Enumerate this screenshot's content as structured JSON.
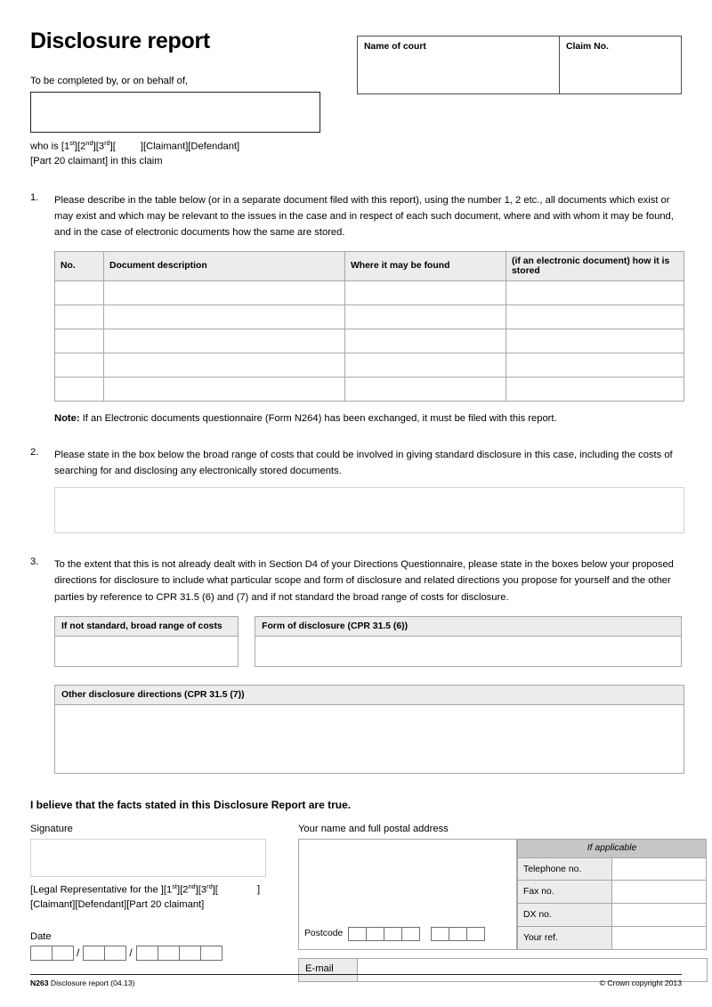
{
  "header": {
    "title": "Disclosure report",
    "lede": "To be completed by, or on behalf of,",
    "who_is_prefix": "who is [",
    "ord_1": "1",
    "ord_1_sup": "st",
    "ord_2": "2",
    "ord_2_sup": "nd",
    "ord_3": "3",
    "ord_3_sup": "rd",
    "who_is_suffix": "][Claimant][Defendant]",
    "who_is_line2": "[Part 20 claimant] in this claim",
    "court_label": "Name of court",
    "claim_label": "Claim No."
  },
  "items": {
    "one": {
      "number": "1.",
      "text": "Please describe in the table below (or in a separate document filed with this report), using the number 1, 2 etc., all documents which exist or may exist and which may be relevant to the issues in the case and in respect of each such document, where and with whom it may be found, and in the case of electronic documents how the same are stored."
    },
    "two": {
      "number": "2.",
      "text": "Please state in the box below the broad range of costs that could be involved in giving standard disclosure in this  case, including the costs of searching for and disclosing any electronically stored documents."
    },
    "three": {
      "number": "3.",
      "text": "To the extent that this is not already dealt with in Section D4 of your Directions Questionnaire, please state in the boxes below your proposed directions for disclosure to include what particular scope and form of disclosure and related directions you propose for yourself and the other parties by reference to CPR 31.5 (6) and (7) and if not standard the broad range of costs for disclosure."
    }
  },
  "doc_table": {
    "headers": [
      "No.",
      "Document description",
      "Where it may be found",
      "(if an electronic document) how it is stored"
    ],
    "rows": [
      [
        "",
        "",
        "",
        ""
      ],
      [
        "",
        "",
        "",
        ""
      ],
      [
        "",
        "",
        "",
        ""
      ],
      [
        "",
        "",
        "",
        ""
      ],
      [
        "",
        "",
        "",
        ""
      ]
    ]
  },
  "note": {
    "bold": "Note:",
    "text": " If an Electronic documents questionnaire (Form N264) has been exchanged, it must be filed with this report."
  },
  "directions_boxes": {
    "costs_heading": "If not standard, broad range of costs",
    "form_heading": "Form of disclosure (CPR 31.5 (6))",
    "other_heading": "Other disclosure directions (CPR 31.5 (7))"
  },
  "statement": {
    "belief": "I believe that the facts stated in this Disclosure Report are true.",
    "signature_label": "Signature",
    "legal_rep_prefix": "[Legal Representative for the ][",
    "legal_rep_suffix": "][",
    "legal_rep_bracket": "]",
    "legal_rep_line2": "[Claimant][Defendant][Part 20 claimant]",
    "date_label": "Date",
    "address_label": "Your name and full postal address",
    "postcode_label": "Postcode",
    "email_label": "E-mail"
  },
  "applicable": {
    "heading": "If applicable",
    "rows": [
      {
        "label": "Telephone no.",
        "value": ""
      },
      {
        "label": "Fax no.",
        "value": ""
      },
      {
        "label": "DX no.",
        "value": ""
      },
      {
        "label": "Your ref.",
        "value": ""
      }
    ]
  },
  "footer": {
    "code": "N263",
    "title": " Disclosure report (04.13)",
    "copyright": "© Crown copyright 2013"
  }
}
